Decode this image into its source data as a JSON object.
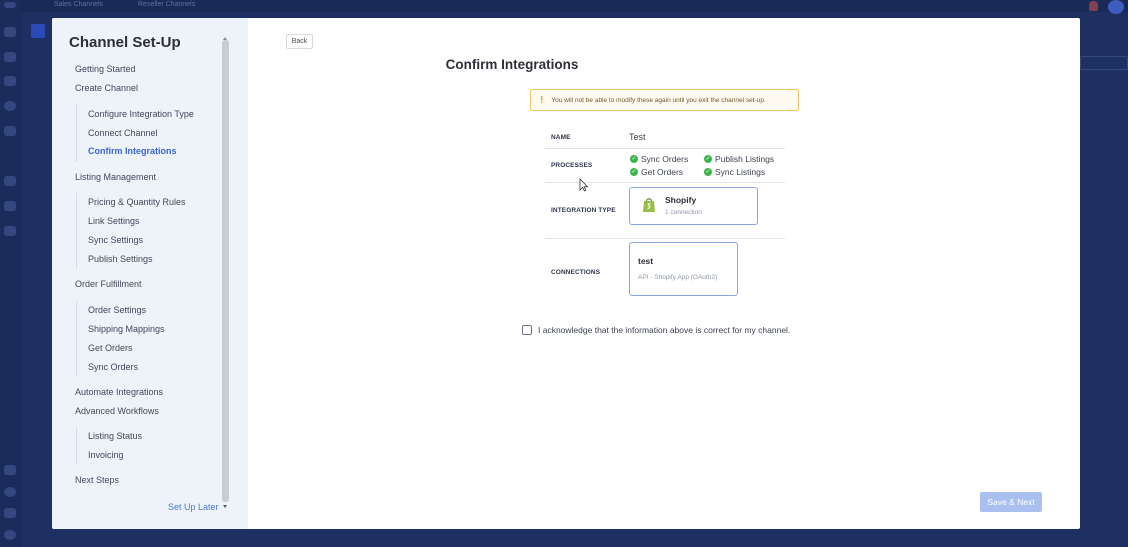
{
  "background": {
    "breadcrumb": [
      "Sales Channels",
      "Reseller Channels"
    ]
  },
  "sidebar": {
    "title": "Channel Set-Up",
    "items": [
      {
        "label": "Getting Started",
        "level": "top",
        "active": false
      },
      {
        "label": "Create Channel",
        "level": "top",
        "active": false
      },
      {
        "label": "Configure Integration Type",
        "level": "sub",
        "active": false
      },
      {
        "label": "Connect Channel",
        "level": "sub",
        "active": false
      },
      {
        "label": "Confirm Integrations",
        "level": "sub",
        "active": true
      },
      {
        "label": "Listing Management",
        "level": "top",
        "active": false
      },
      {
        "label": "Pricing & Quantity Rules",
        "level": "sub",
        "active": false
      },
      {
        "label": "Link Settings",
        "level": "sub",
        "active": false
      },
      {
        "label": "Sync Settings",
        "level": "sub",
        "active": false
      },
      {
        "label": "Publish Settings",
        "level": "sub",
        "active": false
      },
      {
        "label": "Order Fulfillment",
        "level": "top",
        "active": false
      },
      {
        "label": "Order Settings",
        "level": "sub",
        "active": false
      },
      {
        "label": "Shipping Mappings",
        "level": "sub",
        "active": false
      },
      {
        "label": "Get Orders",
        "level": "sub",
        "active": false
      },
      {
        "label": "Sync Orders",
        "level": "sub",
        "active": false
      },
      {
        "label": "Automate Integrations",
        "level": "top",
        "active": false
      },
      {
        "label": "Advanced Workflows",
        "level": "top",
        "active": false
      },
      {
        "label": "Listing Status",
        "level": "sub",
        "active": false
      },
      {
        "label": "Invoicing",
        "level": "sub",
        "active": false
      },
      {
        "label": "Next Steps",
        "level": "top",
        "active": false
      }
    ],
    "setup_later": "Set Up Later"
  },
  "content": {
    "back_label": "Back",
    "title": "Confirm Integrations",
    "warning": "You will not be able to modify these again until you exit the channel set-up.",
    "summary": {
      "name_label": "NAME",
      "name_value": "Test",
      "processes_label": "PROCESSES",
      "processes": [
        "Sync Orders",
        "Publish Listings",
        "Get Orders",
        "Sync Listings"
      ],
      "integration_type_label": "INTEGRATION TYPE",
      "integration": {
        "name": "Shopify",
        "sub": "1 connection"
      },
      "connections_label": "CONNECTIONS",
      "connection": {
        "name": "test",
        "sub": "API - Shopify App (OAuth2)"
      }
    },
    "acknowledge": "I acknowledge that the information above is correct for my channel.",
    "save_label": "Save & Next"
  },
  "colors": {
    "accent": "#3a67d6",
    "success": "#3bb44a",
    "warning_border": "#f0c46e",
    "save_disabled": "#a9c0f1"
  }
}
